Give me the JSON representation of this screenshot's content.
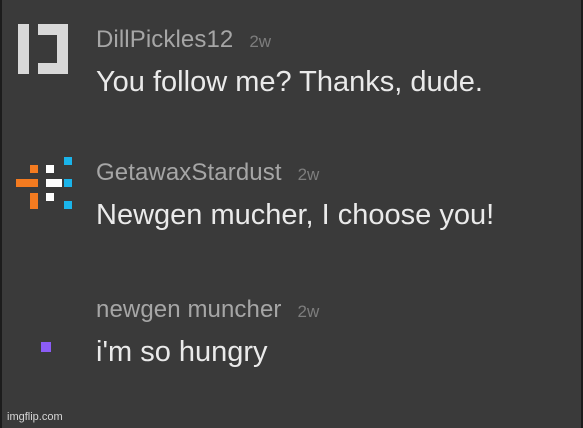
{
  "comments": [
    {
      "username": "DillPickles12",
      "time": "2w",
      "text": "You follow me? Thanks, dude.",
      "avatar_icon": "pixel-bracket-avatar-icon",
      "avatar_colors": [
        "#d8d8d8"
      ]
    },
    {
      "username": "GetawaxStardust",
      "time": "2w",
      "text": "Newgen mucher, I choose you!",
      "avatar_icon": "pixel-orange-cyan-avatar-icon",
      "avatar_colors": [
        "#f47b20",
        "#1ab4ea"
      ]
    },
    {
      "username": "newgen muncher",
      "time": "2w",
      "text": "i'm so hungry",
      "avatar_icon": "purple-dot-avatar-icon",
      "avatar_colors": [
        "#8b5cf6"
      ]
    }
  ],
  "watermark": "imgflip.com",
  "colors": {
    "background": "#3a3a3a",
    "username": "#a6a6a6",
    "time": "#7d7d7d",
    "message": "#eaeaea"
  }
}
